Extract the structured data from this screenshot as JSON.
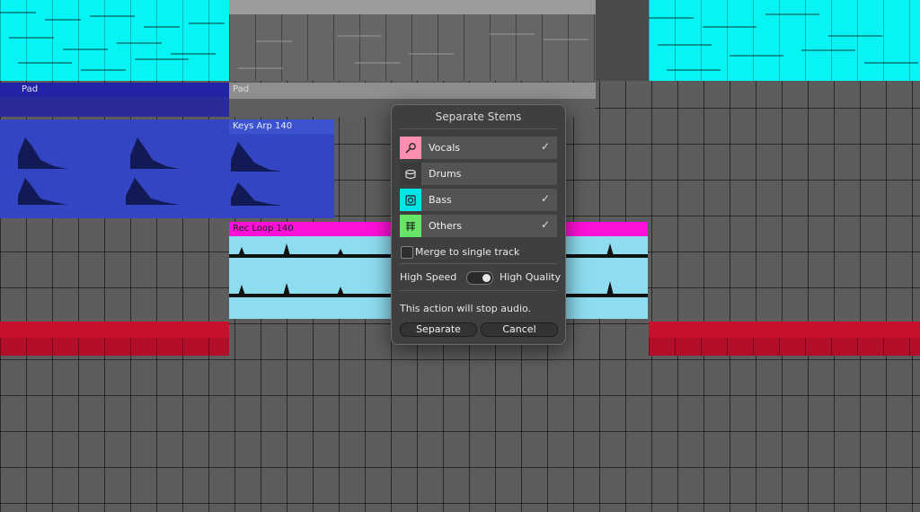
{
  "clips": {
    "pad_left": "Pad",
    "pad_mid": "Pad",
    "keys_arp": "Keys Arp 140",
    "rec_loop": "Rec  Loop  140"
  },
  "dialog": {
    "title": "Separate Stems",
    "stems": [
      {
        "label": "Vocals",
        "checked": true,
        "check_mark": "✓",
        "color": "#ff8fb0",
        "icon": "microphone-icon"
      },
      {
        "label": "Drums",
        "checked": false,
        "check_mark": "",
        "color": "#3a3a3a",
        "icon": "drum-icon"
      },
      {
        "label": "Bass",
        "checked": true,
        "check_mark": "✓",
        "color": "#00e5e5",
        "icon": "speaker-icon"
      },
      {
        "label": "Others",
        "checked": true,
        "check_mark": "✓",
        "color": "#66e566",
        "icon": "sheet-music-icon"
      }
    ],
    "merge_label": "Merge to single track",
    "merge_checked": false,
    "speed_label": "High Speed",
    "quality_label": "High Quality",
    "quality_selected": "High Quality",
    "warning": "This action will stop audio.",
    "separate_label": "Separate",
    "cancel_label": "Cancel"
  },
  "colors": {
    "cyan_clip": "#00ffff",
    "pad_clip": "#2323a8",
    "keys_clip": "#3345c2",
    "rec_header": "#ff10d8",
    "rec_body": "#8ddcf0",
    "red_clip": "#c8102e"
  }
}
